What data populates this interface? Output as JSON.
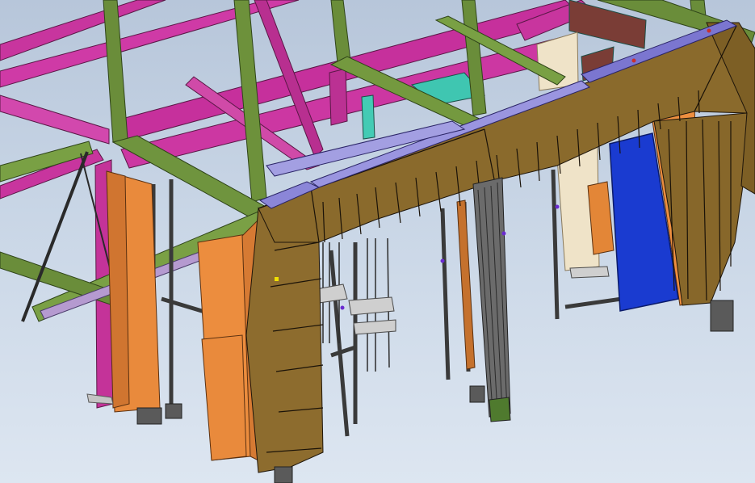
{
  "app": {
    "view": "cad-3d-model-viewport"
  },
  "colors": {
    "background_top": "#b7c6da",
    "background_bottom": "#dde6f1",
    "magenta_beam": "#c8359e",
    "green_beam": "#6a8d3a",
    "orange_column": "#e98a3c",
    "gold_cladding": "#8a6a2c",
    "blue_panel": "#1a3bd0",
    "lavender_top": "#8b86d8",
    "cream_panel": "#efe3c8",
    "dark_steel": "#3a3a3a",
    "teal_element": "#3fc6b1",
    "red_brown_plate": "#7a3d36"
  },
  "model": {
    "parts": [
      {
        "name": "frame-beams-magenta",
        "color": "magenta_beam"
      },
      {
        "name": "frame-beams-green",
        "color": "green_beam"
      },
      {
        "name": "columns-orange",
        "color": "orange_column"
      },
      {
        "name": "gantry-cladding",
        "color": "gold_cladding"
      },
      {
        "name": "door-panel-blue",
        "color": "blue_panel"
      },
      {
        "name": "top-rail-lavender",
        "color": "lavender_top"
      },
      {
        "name": "guide-rails-dark",
        "color": "dark_steel"
      }
    ]
  }
}
